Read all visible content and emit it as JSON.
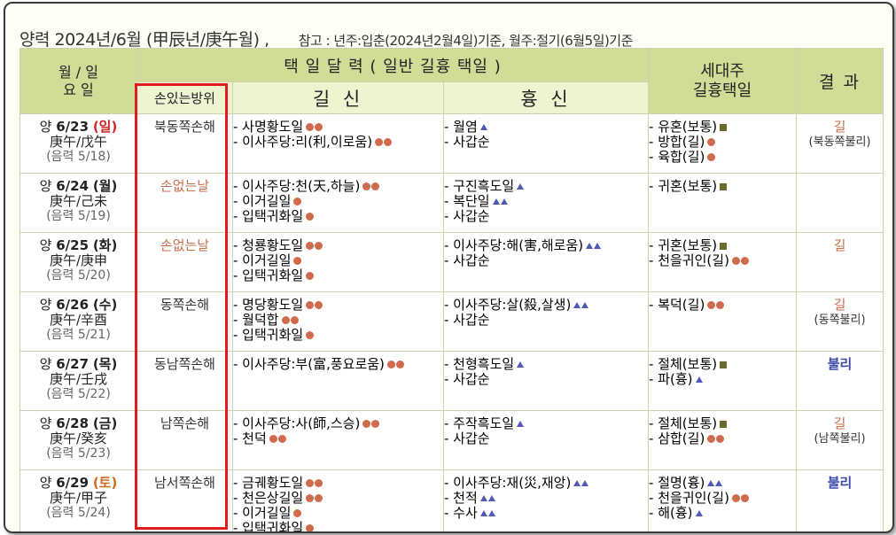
{
  "header": {
    "main": "양력 2024년/6월 (甲辰년/庚午월) ,",
    "note": "참고 : 년주:입춘(2024년2월4일)기준,     월주:절기(6월5일)기준"
  },
  "table": {
    "col_date": "월 / 일\n요 일",
    "col_taek": "택 일 달 력 ( 일반 길흉 택일 )",
    "col_seidae": "세대주\n길흉택일",
    "col_result": "결  과",
    "col_son": "손있는방위",
    "col_gil": "길 신",
    "col_hyung": "흉 신"
  },
  "rows": [
    {
      "date_prefix": "양 ",
      "date": "6/23",
      "weekday": "(일)",
      "weekday_type": "sun",
      "ganji": "庚午/戊午",
      "lunar": "(음력 5/18)",
      "son": "북동쪽손해",
      "son_nohand": false,
      "gil": [
        {
          "text": "- 사명황도일",
          "marks": [
            "dot",
            "dot"
          ]
        },
        {
          "text": "- 이사주당:리(利,이로움)",
          "marks": [
            "dot",
            "dot"
          ]
        }
      ],
      "hyung": [
        {
          "text": "- 월염",
          "marks": [
            "tri"
          ]
        },
        {
          "text": "- 사갑순",
          "marks": []
        }
      ],
      "seidae": [
        {
          "text": "- 유혼(보통)",
          "marks": [
            "sq"
          ]
        },
        {
          "text": "- 방합(길)",
          "marks": [
            "dot"
          ]
        },
        {
          "text": "- 육합(길)",
          "marks": [
            "dot"
          ]
        }
      ],
      "result": "길",
      "result_type": "gil",
      "result_sub": "(북동쪽불리)"
    },
    {
      "date_prefix": "양 ",
      "date": "6/24",
      "weekday": "(월)",
      "weekday_type": "normal",
      "ganji": "庚午/己未",
      "lunar": "(음력 5/19)",
      "son": "손없는날",
      "son_nohand": true,
      "gil": [
        {
          "text": "- 이사주당:천(天,하늘)",
          "marks": [
            "dot",
            "dot"
          ]
        },
        {
          "text": "- 이거길일",
          "marks": [
            "dot"
          ]
        },
        {
          "text": "- 입택귀화일",
          "marks": [
            "dot"
          ]
        }
      ],
      "hyung": [
        {
          "text": "- 구진흑도일",
          "marks": [
            "tri"
          ]
        },
        {
          "text": "- 복단일",
          "marks": [
            "tri",
            "tri"
          ]
        },
        {
          "text": "- 사갑순",
          "marks": []
        }
      ],
      "seidae": [
        {
          "text": "- 귀혼(보통)",
          "marks": [
            "sq"
          ]
        }
      ],
      "result": "",
      "result_type": "none",
      "result_sub": ""
    },
    {
      "date_prefix": "양 ",
      "date": "6/25",
      "weekday": "(화)",
      "weekday_type": "normal",
      "ganji": "庚午/庚申",
      "lunar": "(음력 5/20)",
      "son": "손없는날",
      "son_nohand": true,
      "gil": [
        {
          "text": "- 청룡황도일",
          "marks": [
            "dot",
            "dot"
          ]
        },
        {
          "text": "- 이거길일",
          "marks": [
            "dot"
          ]
        },
        {
          "text": "- 입택귀화일",
          "marks": [
            "dot"
          ]
        }
      ],
      "hyung": [
        {
          "text": "- 이사주당:해(害,해로움)",
          "marks": [
            "tri",
            "tri"
          ]
        },
        {
          "text": "- 사갑순",
          "marks": []
        }
      ],
      "seidae": [
        {
          "text": "- 귀혼(보통)",
          "marks": [
            "sq"
          ]
        },
        {
          "text": "- 천을귀인(길)",
          "marks": [
            "dot",
            "dot"
          ]
        }
      ],
      "result": "길",
      "result_type": "gil",
      "result_sub": ""
    },
    {
      "date_prefix": "양 ",
      "date": "6/26",
      "weekday": "(수)",
      "weekday_type": "normal",
      "ganji": "庚午/辛酉",
      "lunar": "(음력 5/21)",
      "son": "동쪽손해",
      "son_nohand": false,
      "gil": [
        {
          "text": "- 명당황도일",
          "marks": [
            "dot",
            "dot"
          ]
        },
        {
          "text": "- 월덕합",
          "marks": [
            "dot",
            "dot"
          ]
        },
        {
          "text": "- 입택귀화일",
          "marks": [
            "dot"
          ]
        }
      ],
      "hyung": [
        {
          "text": "- 이사주당:살(殺,살생)",
          "marks": [
            "tri",
            "tri"
          ]
        },
        {
          "text": "- 사갑순",
          "marks": []
        }
      ],
      "seidae": [
        {
          "text": "- 복덕(길)",
          "marks": [
            "dot",
            "dot"
          ]
        }
      ],
      "result": "길",
      "result_type": "gil",
      "result_sub": "(동쪽불리)"
    },
    {
      "date_prefix": "양 ",
      "date": "6/27",
      "weekday": "(목)",
      "weekday_type": "normal",
      "ganji": "庚午/壬戌",
      "lunar": "(음력 5/22)",
      "son": "동남쪽손해",
      "son_nohand": false,
      "gil": [
        {
          "text": "- 이사주당:부(富,풍요로움)",
          "marks": [
            "dot",
            "dot"
          ]
        }
      ],
      "hyung": [
        {
          "text": "- 천형흑도일",
          "marks": [
            "tri"
          ]
        },
        {
          "text": "- 사갑순",
          "marks": []
        }
      ],
      "seidae": [
        {
          "text": "- 절체(보통)",
          "marks": [
            "sq"
          ]
        },
        {
          "text": "- 파(흉)",
          "marks": [
            "tri"
          ]
        }
      ],
      "result": "불리",
      "result_type": "bul",
      "result_sub": ""
    },
    {
      "date_prefix": "양 ",
      "date": "6/28",
      "weekday": "(금)",
      "weekday_type": "normal",
      "ganji": "庚午/癸亥",
      "lunar": "(음력 5/23)",
      "son": "남쪽손해",
      "son_nohand": false,
      "gil": [
        {
          "text": "- 이사주당:사(師,스승)",
          "marks": [
            "dot",
            "dot"
          ]
        },
        {
          "text": "- 천덕",
          "marks": [
            "dot",
            "dot"
          ]
        }
      ],
      "hyung": [
        {
          "text": "- 주작흑도일",
          "marks": [
            "tri"
          ]
        },
        {
          "text": "- 사갑순",
          "marks": []
        }
      ],
      "seidae": [
        {
          "text": "- 절체(보통)",
          "marks": [
            "sq"
          ]
        },
        {
          "text": "- 삼합(길)",
          "marks": [
            "dot",
            "dot"
          ]
        }
      ],
      "result": "길",
      "result_type": "gil",
      "result_sub": "(남쪽불리)"
    },
    {
      "date_prefix": "양 ",
      "date": "6/29",
      "weekday": "(토)",
      "weekday_type": "sat",
      "ganji": "庚午/甲子",
      "lunar": "(음력 5/24)",
      "son": "남서쪽손해",
      "son_nohand": false,
      "gil": [
        {
          "text": "- 금궤황도일",
          "marks": [
            "dot",
            "dot"
          ]
        },
        {
          "text": "- 천은상길일",
          "marks": [
            "dot",
            "dot"
          ]
        },
        {
          "text": "- 이거길일",
          "marks": [
            "dot"
          ]
        },
        {
          "text": "- 입택귀화일",
          "marks": [
            "dot"
          ]
        }
      ],
      "hyung": [
        {
          "text": "- 이사주당:재(災,재앙)",
          "marks": [
            "tri",
            "tri"
          ]
        },
        {
          "text": "- 천적",
          "marks": [
            "tri",
            "tri"
          ]
        },
        {
          "text": "- 수사",
          "marks": [
            "tri",
            "tri"
          ]
        }
      ],
      "seidae": [
        {
          "text": "- 절명(흉)",
          "marks": [
            "tri",
            "tri"
          ]
        },
        {
          "text": "- 천을귀인(길)",
          "marks": [
            "dot",
            "dot"
          ]
        },
        {
          "text": "- 해(흉)",
          "marks": [
            "tri"
          ]
        }
      ],
      "result": "불리",
      "result_type": "bul",
      "result_sub": ""
    }
  ]
}
